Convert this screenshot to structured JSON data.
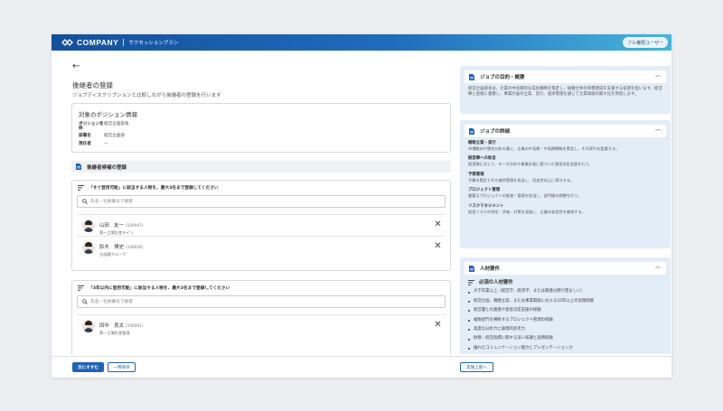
{
  "header": {
    "company": "COMPANY",
    "plan": "サクセッションプラン",
    "user_badge": "フル権限ユーザー",
    "brand_gradient": [
      "#14509c",
      "#47b5dc"
    ]
  },
  "page": {
    "title": "後継者の登録",
    "subtitle": "ジョブディスクリプションと比較しながら後継者の登録を行います"
  },
  "position_info": {
    "heading": "対象のポジション情報",
    "rows": [
      {
        "label": "ポジション名称",
        "value": "経営企画部長"
      },
      {
        "label": "部署名",
        "value": "経営企画部"
      },
      {
        "label": "現任者",
        "value": "ー"
      }
    ]
  },
  "successor_section": {
    "title": "後継者候補の登録"
  },
  "group_now": {
    "heading": "「すぐ登用可能」に該当する人物を、最大3名まで登録してください",
    "search_placeholder": "氏名・社員番号で検索",
    "candidates": [
      {
        "name": "山田　友一",
        "id": "(100047)",
        "dept": "第一工場生産ライン"
      },
      {
        "name": "鈴木　博史",
        "id": "(100029)",
        "dept": "企画課グループ"
      }
    ]
  },
  "group_3yrs": {
    "heading": "「3年以内に登用可能」に該当する人物を、最大3名まで登録してください",
    "search_placeholder": "氏名・社員番号で検索",
    "candidates": [
      {
        "name": "田中　良太",
        "id": "(100091)",
        "dept": "第一工場生産管理"
      }
    ]
  },
  "job_purpose": {
    "title": "ジョブの目的・概要",
    "text": "経営企画部長は、企業の中長期的な成長戦略を策定し、組織全体の目標達成を支援する役割を担います。経営陣と密接に連携し、事業計画の立案、実行、進捗管理を通じて企業価値の最大化を目指します。"
  },
  "job_details": {
    "title": "ジョブの詳細",
    "items": [
      {
        "t": "戦略立案・実行",
        "d": "市場動向や競合分析を基に、企業の中長期・中長期戦略を策定し、その実行を監督する。"
      },
      {
        "t": "経営陣への助言",
        "d": "経営陣に対して、データ分析や事業計画に基づいた意思決定支援を行う。"
      },
      {
        "t": "予算管理",
        "d": "予算の策定とその進捗管理を担当し、収益性向上に寄与する。"
      },
      {
        "t": "プロジェクト管理",
        "d": "重要なプロジェクトの推進・管理を担当し、部門間の調整を行う。"
      },
      {
        "t": "リスクマネジメント",
        "d": "経営リスクの特定・評価・対策を実施し、企業の安定性を確保する。"
      }
    ]
  },
  "requirements": {
    "title": "人材要件",
    "subheading": "必須の人材要件",
    "items": [
      "大学卒業以上（経営学、経済学、または関連分野が望ましい）",
      "経営企画、戦略立案、または事業開発における10年以上の実務経験",
      "経営層との連携や意思決定支援の経験",
      "複数部門を横断するプロジェクト管理の経験",
      "高度な分析力と論理的思考力",
      "財務・経営指標に関する深い知識と実務経験",
      "優れたコミュニケーション能力とプレゼンテーション力"
    ]
  },
  "footer": {
    "next": "次にすすむ",
    "save": "一時保存",
    "senior": "実施上部へ"
  }
}
